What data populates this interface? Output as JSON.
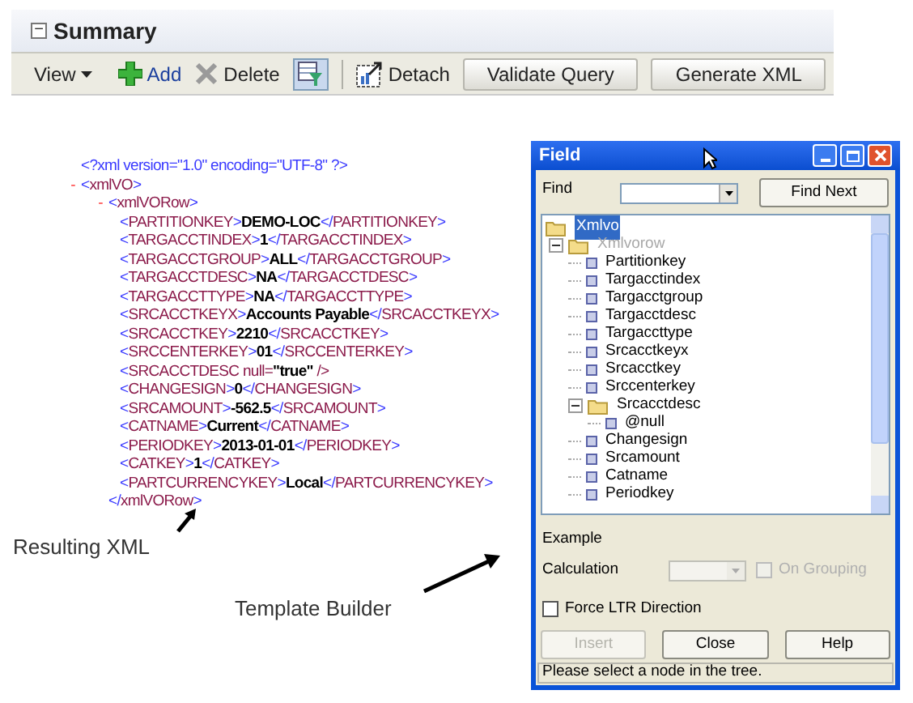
{
  "panel": {
    "title": "Summary",
    "expanded": true,
    "toggle": "−",
    "toolbar": [
      {
        "kind": "menu",
        "label": "View"
      },
      {
        "kind": "add",
        "label": "Add"
      },
      {
        "kind": "delete",
        "label": "Delete"
      },
      {
        "kind": "filter",
        "pressed": true
      },
      {
        "kind": "separator"
      },
      {
        "kind": "detach",
        "label": "Detach"
      },
      {
        "kind": "button",
        "label": "Validate Query"
      },
      {
        "kind": "button",
        "label": "Generate XML"
      }
    ]
  },
  "xml": {
    "declaration": "<?xml version=\"1.0\" encoding=\"UTF-8\" ?>",
    "nodes": [
      {
        "kind": "node",
        "toggle": "-",
        "open": "<xmlVO>",
        "children": [
          {
            "kind": "node",
            "toggle": "-",
            "open": "<xmlVORow>",
            "close": "</xmlVORow>",
            "children": [
              {
                "kind": "element",
                "open": "<PARTITIONKEY>",
                "value": "DEMO-LOC",
                "close": "</PARTITIONKEY>"
              },
              {
                "kind": "element",
                "open": "<TARGACCTINDEX>",
                "value": "1",
                "close": "</TARGACCTINDEX>"
              },
              {
                "kind": "element",
                "open": "<TARGACCTGROUP>",
                "value": "ALL",
                "close": "</TARGACCTGROUP>"
              },
              {
                "kind": "element",
                "open": "<TARGACCTDESC>",
                "value": "NA",
                "close": "</TARGACCTDESC>"
              },
              {
                "kind": "element",
                "open": "<TARGACCTTYPE>",
                "value": "NA",
                "close": "</TARGACCTTYPE>"
              },
              {
                "kind": "element",
                "open": "<SRCACCTKEYX>",
                "value": "Accounts Payable",
                "close": "</SRCACCTKEYX>"
              },
              {
                "kind": "element",
                "open": "<SRCACCTKEY>",
                "value": "2210",
                "close": "</SRCACCTKEY>"
              },
              {
                "kind": "element",
                "open": "<SRCCENTERKEY>",
                "value": "01",
                "close": "</SRCCENTERKEY>"
              },
              {
                "kind": "element",
                "open": "<SRCACCTDESC null=",
                "value": "\"true\"",
                "close": " />"
              },
              {
                "kind": "element",
                "open": "<CHANGESIGN>",
                "value": "0",
                "close": "</CHANGESIGN>"
              },
              {
                "kind": "element",
                "open": "<SRCAMOUNT>",
                "value": "-562.5",
                "close": "</SRCAMOUNT>"
              },
              {
                "kind": "element",
                "open": "<CATNAME>",
                "value": "Current",
                "close": "</CATNAME>"
              },
              {
                "kind": "element",
                "open": "<PERIODKEY>",
                "value": "2013-01-01",
                "close": "</PERIODKEY>"
              },
              {
                "kind": "element",
                "open": "<CATKEY>",
                "value": "1",
                "close": "</CATKEY>"
              },
              {
                "kind": "element",
                "open": "<PARTCURRENCYKEY>",
                "value": "Local",
                "close": "</PARTCURRENCYKEY>"
              }
            ]
          }
        ]
      }
    ]
  },
  "callouts": [
    {
      "label": "Resulting XML"
    },
    {
      "label": "Template Builder"
    }
  ],
  "dialog": {
    "title": "Field",
    "find_label": "Find",
    "find_button": "Find Next",
    "tree": [
      {
        "kind": "folder",
        "label": "Xmlvo",
        "selected": true,
        "disabled": false,
        "children": [
          {
            "kind": "folder",
            "label": "Xmlvorow",
            "selected": false,
            "disabled": true,
            "expanded": true,
            "children": [
              {
                "kind": "leaf",
                "label": "Partitionkey",
                "selected": false,
                "disabled": false
              },
              {
                "kind": "leaf",
                "label": "Targacctindex",
                "selected": false,
                "disabled": false
              },
              {
                "kind": "leaf",
                "label": "Targacctgroup",
                "selected": false,
                "disabled": false
              },
              {
                "kind": "leaf",
                "label": "Targacctdesc",
                "selected": false,
                "disabled": false
              },
              {
                "kind": "leaf",
                "label": "Targaccttype",
                "selected": false,
                "disabled": false
              },
              {
                "kind": "leaf",
                "label": "Srcacctkeyx",
                "selected": false,
                "disabled": false
              },
              {
                "kind": "leaf",
                "label": "Srcacctkey",
                "selected": false,
                "disabled": false
              },
              {
                "kind": "leaf",
                "label": "Srccenterkey",
                "selected": false,
                "disabled": false
              },
              {
                "kind": "folder",
                "label": "Srcacctdesc",
                "selected": false,
                "disabled": false,
                "expanded": true,
                "children": [
                  {
                    "kind": "leaf",
                    "label": "@null",
                    "selected": false,
                    "disabled": false
                  }
                ]
              },
              {
                "kind": "leaf",
                "label": "Changesign",
                "selected": false,
                "disabled": false
              },
              {
                "kind": "leaf",
                "label": "Srcamount",
                "selected": false,
                "disabled": false
              },
              {
                "kind": "leaf",
                "label": "Catname",
                "selected": false,
                "disabled": false
              },
              {
                "kind": "leaf",
                "label": "Periodkey",
                "selected": false,
                "disabled": false
              }
            ]
          }
        ]
      }
    ],
    "example_label": "Example",
    "calculation_label": "Calculation",
    "calculation_disabled": true,
    "on_grouping": {
      "label": "On Grouping",
      "checked": false,
      "disabled": true
    },
    "force_ltr": {
      "label": "Force LTR Direction",
      "checked": false,
      "disabled": false
    },
    "buttons": [
      {
        "label": "Insert",
        "disabled": true
      },
      {
        "label": "Close",
        "disabled": false
      },
      {
        "label": "Help",
        "disabled": false
      }
    ],
    "status": "Please select a node in the tree."
  }
}
